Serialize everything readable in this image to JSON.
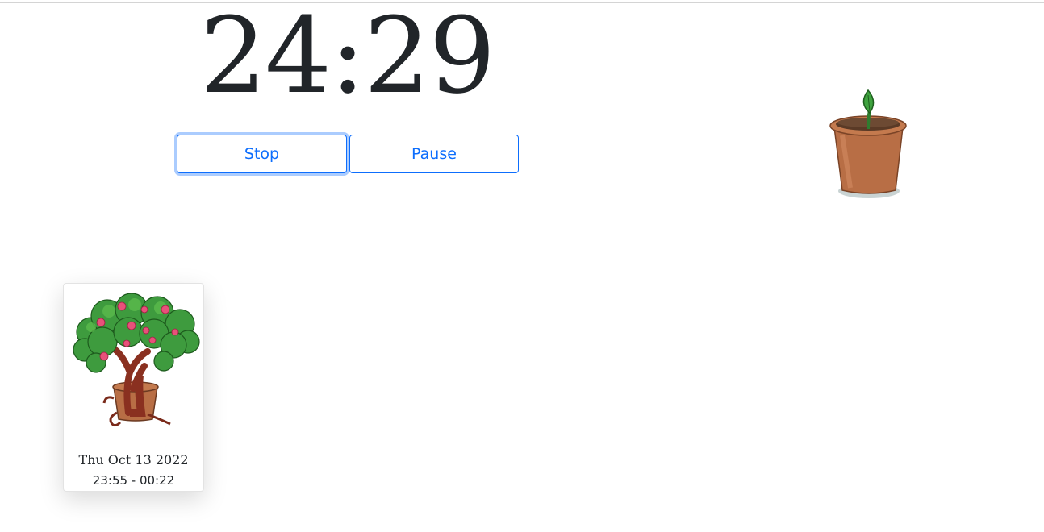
{
  "timer": {
    "display": "24:29"
  },
  "controls": {
    "stop_label": "Stop",
    "pause_label": "Pause"
  },
  "current_plant": {
    "icon": "seedling-pot-icon"
  },
  "history": [
    {
      "icon": "flowering-tree-icon",
      "date": "Thu Oct 13 2022",
      "time_range": "23:55 - 00:22"
    }
  ],
  "colors": {
    "primary": "#0d6efd",
    "text": "#212529",
    "pot": "#b9714a",
    "leaf": "#3a9a3a",
    "blossom": "#e8517a"
  }
}
